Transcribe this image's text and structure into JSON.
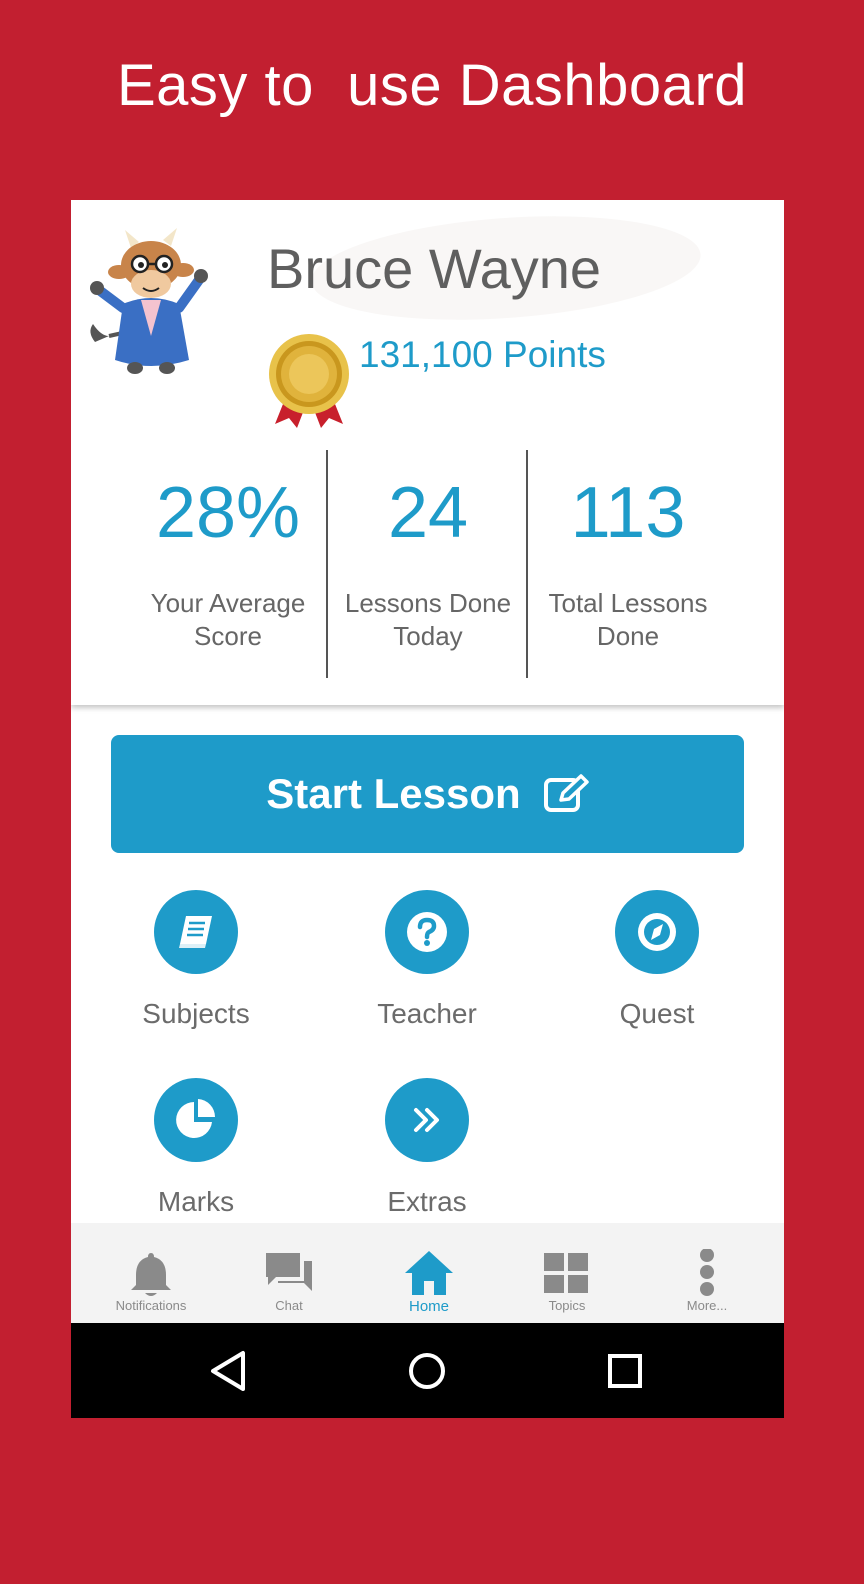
{
  "promo": {
    "title": "Easy to  use Dashboard"
  },
  "profile": {
    "name": "Bruce Wayne",
    "points": "131,100 Points"
  },
  "stats": [
    {
      "value": "28%",
      "label": "Your Average Score"
    },
    {
      "value": "24",
      "label": "Lessons Done Today"
    },
    {
      "value": "113",
      "label": "Total Lessons Done"
    }
  ],
  "start_lesson": {
    "label": "Start Lesson",
    "icon": "edit-icon"
  },
  "menu": [
    {
      "label": "Subjects",
      "icon": "book-icon"
    },
    {
      "label": "Teacher",
      "icon": "question-icon"
    },
    {
      "label": "Quest",
      "icon": "compass-icon"
    },
    {
      "label": "Marks",
      "icon": "pie-chart-icon"
    },
    {
      "label": "Extras",
      "icon": "double-chevron-icon"
    }
  ],
  "bottom_nav": [
    {
      "label": "Notifications",
      "icon": "bell-icon"
    },
    {
      "label": "Chat",
      "icon": "chat-icon"
    },
    {
      "label": "Home",
      "icon": "home-icon",
      "active": true
    },
    {
      "label": "Topics",
      "icon": "grid-icon"
    },
    {
      "label": "More...",
      "icon": "more-vertical-icon"
    }
  ],
  "colors": {
    "brand_red": "#c21f30",
    "accent_blue": "#1e9bc9",
    "text_gray": "#666666"
  }
}
